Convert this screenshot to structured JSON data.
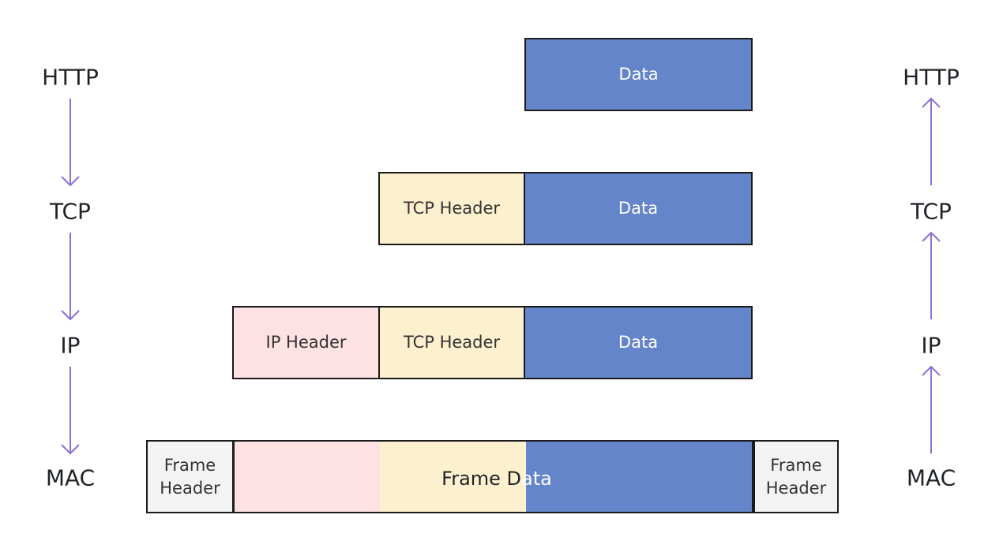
{
  "colors": {
    "arrow": "#8b6fd6",
    "data": "#6485ca",
    "tcp_header": "#fdf0cf",
    "ip_header": "#fde1e3",
    "frame_header": "#f3f3f3"
  },
  "left_stack": {
    "direction": "down",
    "layers": [
      "HTTP",
      "TCP",
      "IP",
      "MAC"
    ]
  },
  "right_stack": {
    "direction": "up",
    "layers": [
      "HTTP",
      "TCP",
      "IP",
      "MAC"
    ]
  },
  "rows": {
    "http": {
      "data": "Data"
    },
    "tcp": {
      "tcp_header": "TCP Header",
      "data": "Data"
    },
    "ip": {
      "ip_header": "IP Header",
      "tcp_header": "TCP Header",
      "data": "Data"
    },
    "mac": {
      "frame_header_left": "Frame Header",
      "frame_data_prefix": "Frame D",
      "frame_data_suffix": "ata",
      "frame_header_right": "Frame Header"
    }
  }
}
